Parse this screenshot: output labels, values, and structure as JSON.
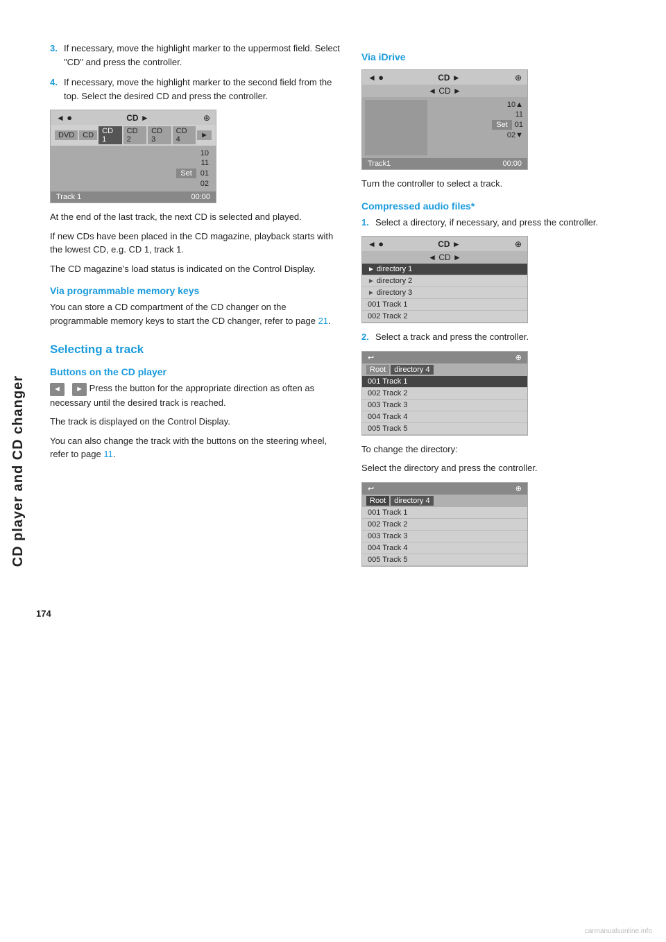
{
  "sidebar": {
    "label": "CD player and CD changer"
  },
  "page_number": "174",
  "left_col": {
    "steps": [
      {
        "num": "3.",
        "text": "If necessary, move the highlight marker to the uppermost field. Select \"CD\" and press the controller."
      },
      {
        "num": "4.",
        "text": "If necessary, move the highlight marker to the second field from the top. Select the desired CD and press the controller."
      }
    ],
    "cd_ui": {
      "topbar_left": "◄",
      "topbar_center": "CD ►",
      "topbar_icon": "⊕",
      "cd_tabs": [
        "DVD",
        "CD",
        "CD 1",
        "CD 2",
        "CD 3",
        "CD 4",
        "►"
      ],
      "active_tab": "CD 1",
      "rows": [
        "10",
        "11",
        "01",
        "02"
      ],
      "set_label": "Set",
      "track_label": "Track 1",
      "time_label": "00:00"
    },
    "paragraphs": [
      "At the end of the last track, the next CD is selected and played.",
      "If new CDs have been placed in the CD magazine, playback starts with the lowest CD, e.g. CD 1, track 1.",
      "The CD magazine's load status is indicated on the Control Display."
    ],
    "via_prog_heading": "Via programmable memory keys",
    "via_prog_text": "You can store a CD compartment of the CD changer on the programmable memory keys to start the CD changer, refer to page 21.",
    "selecting_heading": "Selecting a track",
    "buttons_heading": "Buttons on the CD player",
    "buttons_text": "Press the button for the appropriate direction as often as necessary until the desired track is reached.",
    "buttons_text2": "The track is displayed on the Control Display.",
    "buttons_text3": "You can also change the track with the buttons on the steering wheel, refer to page 11."
  },
  "right_col": {
    "via_idrive_heading": "Via iDrive",
    "idrive_ui": {
      "topbar_left": "◄",
      "topbar_center_icon": "●",
      "topbar_center": "CD ►",
      "topbar_right": "⊕",
      "sub_row": "◄ CD ►",
      "rows": [
        "10▲",
        "11",
        "01",
        "02▼"
      ],
      "set_label": "Set",
      "track_label": "Track1",
      "time_label": "00:00"
    },
    "idrive_instruction": "Turn the controller to select a track.",
    "compressed_heading": "Compressed audio files*",
    "compressed_step1": {
      "num": "1.",
      "text": "Select a directory, if necessary, and press the controller."
    },
    "dir_ui": {
      "topbar_left": "◄",
      "topbar_center_icon": "●",
      "topbar_center": "CD ►",
      "topbar_right": "⊕",
      "sub_row": "◄ CD ►",
      "items": [
        {
          "label": "directory 1",
          "highlight": true
        },
        {
          "label": "directory 2",
          "highlight": false
        },
        {
          "label": "directory 3",
          "highlight": false
        },
        {
          "label": "001 Track 1",
          "highlight": false
        },
        {
          "label": "002 Track 2",
          "highlight": false
        }
      ]
    },
    "compressed_step2": {
      "num": "2.",
      "text": "Select a track and press the controller."
    },
    "track_ui_1": {
      "topbar_left": "↩",
      "topbar_right": "⊕",
      "breadcrumb": [
        "Root",
        "directory 4"
      ],
      "items": [
        {
          "label": "001 Track  1",
          "highlight": true
        },
        {
          "label": "002 Track  2",
          "highlight": false
        },
        {
          "label": "003 Track  3",
          "highlight": false
        },
        {
          "label": "004 Track  4",
          "highlight": false
        },
        {
          "label": "005 Track  5",
          "highlight": false
        }
      ]
    },
    "change_dir_text1": "To change the directory:",
    "change_dir_text2": "Select the directory and press the controller.",
    "track_ui_2": {
      "topbar_left": "↩",
      "topbar_right": "⊕",
      "breadcrumb_root": "Root",
      "breadcrumb_dir": "directory 4",
      "breadcrumb_root_active": true,
      "items": [
        {
          "label": "001 Track  1",
          "highlight": false
        },
        {
          "label": "002 Track  2",
          "highlight": false
        },
        {
          "label": "003 Track  3",
          "highlight": false
        },
        {
          "label": "004 Track  4",
          "highlight": false
        },
        {
          "label": "005 Track  5",
          "highlight": false
        }
      ]
    }
  }
}
